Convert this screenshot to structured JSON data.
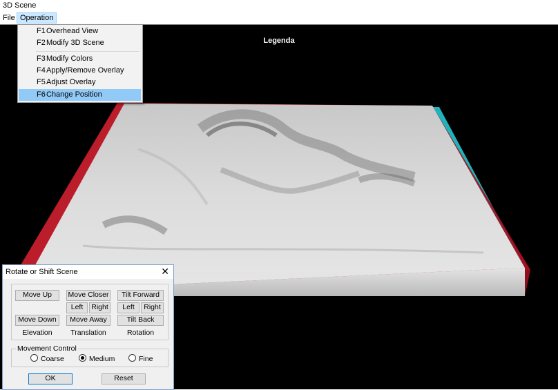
{
  "window": {
    "title": "3D Scene"
  },
  "menubar": {
    "file": "File",
    "operation": "Operation"
  },
  "operation_menu": {
    "items": [
      {
        "key": "F1",
        "label": "Overhead View"
      },
      {
        "key": "F2",
        "label": "Modify 3D Scene"
      },
      {
        "key": "F3",
        "label": "Modify Colors"
      },
      {
        "key": "F4",
        "label": "Apply/Remove Overlay"
      },
      {
        "key": "F5",
        "label": "Adjust Overlay"
      },
      {
        "key": "F6",
        "label": "Change Position"
      }
    ],
    "highlighted": "F6"
  },
  "scene": {
    "legend_title": "Legenda"
  },
  "rotate_panel": {
    "title": "Rotate or Shift Scene",
    "close": "✕",
    "elevation": {
      "up": "Move Up",
      "down": "Move Down",
      "caption": "Elevation"
    },
    "translation": {
      "closer": "Move Closer",
      "left": "Left",
      "right": "Right",
      "away": "Move Away",
      "caption": "Translation"
    },
    "rotation": {
      "forward": "Tilt Forward",
      "left": "Left",
      "right": "Right",
      "back": "Tilt Back",
      "caption": "Rotation"
    },
    "movement_control": {
      "label": "Movement Control",
      "options": [
        "Coarse",
        "Medium",
        "Fine"
      ],
      "selected": "Medium"
    },
    "ok": "OK",
    "reset": "Reset"
  }
}
